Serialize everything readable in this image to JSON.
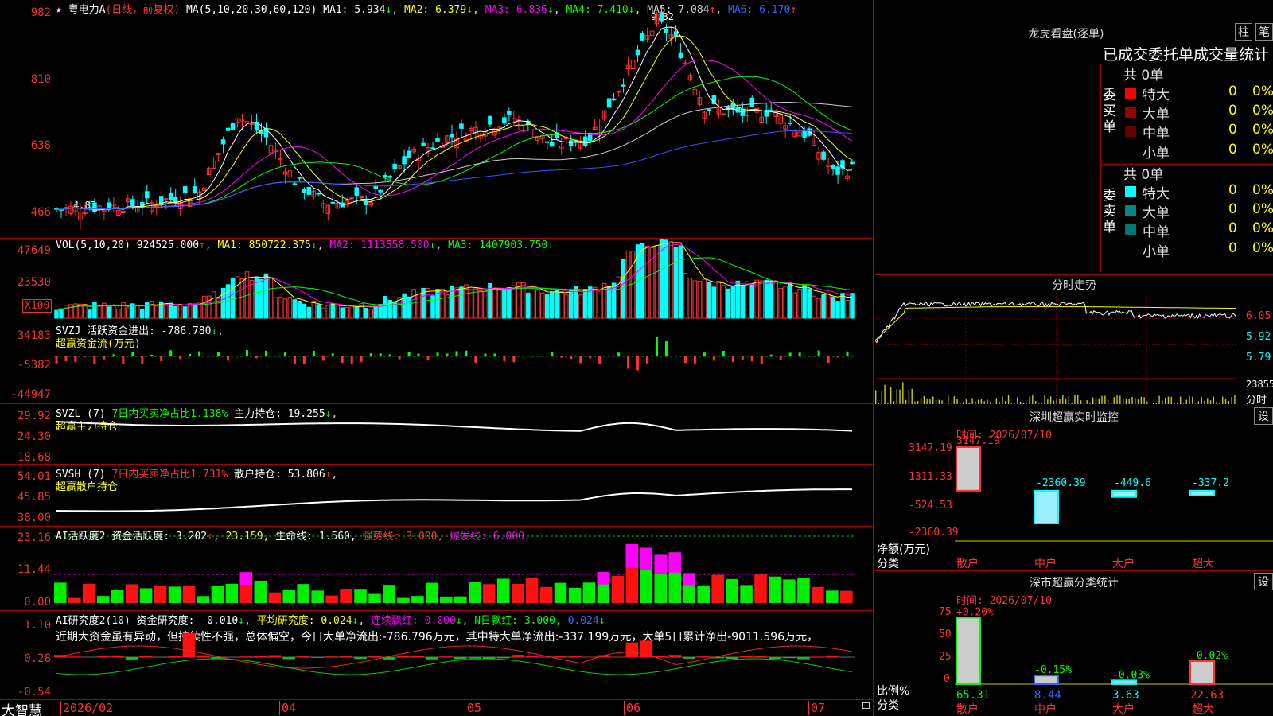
{
  "stock": {
    "name": "粤电力A",
    "mode": "(日线，前复权)",
    "ma_label": "MA(5,10,20,30,60,120)",
    "ma": [
      {
        "k": "MA1:",
        "v": "5.934",
        "arrow": "↓"
      },
      {
        "k": "MA2:",
        "v": "6.379",
        "arrow": "↓"
      },
      {
        "k": "MA3:",
        "v": "6.836",
        "arrow": "↓"
      },
      {
        "k": "MA4:",
        "v": "7.410",
        "arrow": "↓"
      },
      {
        "k": "MA5:",
        "v": "7.084",
        "arrow": "↑"
      },
      {
        "k": "MA6:",
        "v": "6.170",
        "arrow": "↑"
      }
    ],
    "y_ticks": [
      "982",
      "810",
      "638",
      "466"
    ],
    "high_mark": "9.82",
    "low_mark": "4.87"
  },
  "colors": {
    "up": "#ff3333",
    "down": "#00ffff",
    "ma1": "#ffffff",
    "ma2": "#ffff00",
    "ma3": "#ff00ff",
    "ma4": "#00ff00",
    "ma5": "#cccccc",
    "ma6": "#3355ff"
  },
  "vol": {
    "label": "VOL(5,10,20)",
    "value": "924525.000",
    "ma1": "MA1: 850722.375",
    "ma2": "MA2: 1113558.500",
    "ma3": "MA3: 1407903.750",
    "y_ticks": [
      "47649",
      "23530"
    ],
    "unit": "X100"
  },
  "svzj": {
    "label": "SVZJ",
    "text": "活跃资金进出: -786.780",
    "sub": "超赢资金流(万元)",
    "y_ticks": [
      "34183",
      "-5382",
      "-44947"
    ]
  },
  "svzl": {
    "label": "SVZL (7)",
    "text": "7日内买卖净占比1.138%",
    "main": "主力持仓: 19.255",
    "sub": "超赢主力持仓",
    "y_ticks": [
      "29.92",
      "24.30",
      "18.68"
    ]
  },
  "svsh": {
    "label": "SVSH (7)",
    "text": "7日内买卖净占比1.731%",
    "main": "散户持仓: 53.806",
    "sub": "超赢散户持仓",
    "y_ticks": [
      "54.01",
      "45.85",
      "38.00"
    ]
  },
  "ai2": {
    "label": "AI活跃度2",
    "t1": "资金活跃度: 3.202",
    "t2": "23.159,",
    "t3": "生命线: 1.560,",
    "t4": "强势线: 3.000,",
    "t5": "爆发线: 6.000,",
    "y_ticks": [
      "23.16",
      "11.44",
      "0.00"
    ]
  },
  "ai3": {
    "label": "AI研究度2(10)",
    "t1": "资金研究度: -0.010",
    "t2": "平均研究度: 0.024",
    "t3": "连续飘红: 0.000",
    "t4": "N日飘红: 3.000,",
    "t5": "0.024",
    "comment": "近期大资金虽有异动，但持续性不强，总体偏空，今日大单净流出:-786.796万元，其中特大单净流出:-337.199万元，大单5日累计净出-9011.596万元，",
    "y_ticks": [
      "1.10",
      "0.28",
      "-0.54"
    ]
  },
  "xaxis": {
    "brand": "大智慧",
    "labels": [
      "2026/02",
      "04",
      "05",
      "06",
      "07"
    ]
  },
  "lhb": {
    "title": "龙虎看盘(逐单)",
    "btn1": "柱",
    "btn2": "笔",
    "header": "已成交委托单成交量统计",
    "buy": {
      "side": "委买单",
      "count": "共 0单",
      "rows": [
        {
          "name": "特大",
          "v": "0",
          "p": "0%"
        },
        {
          "name": "大单",
          "v": "0",
          "p": "0%"
        },
        {
          "name": "中单",
          "v": "0",
          "p": "0%"
        },
        {
          "name": "小单",
          "v": "0",
          "p": "0%"
        }
      ]
    },
    "sell": {
      "side": "委卖单",
      "count": "共 0单",
      "rows": [
        {
          "name": "特大",
          "v": "0",
          "p": "0%"
        },
        {
          "name": "大单",
          "v": "0",
          "p": "0%"
        },
        {
          "name": "中单",
          "v": "0",
          "p": "0%"
        },
        {
          "name": "小单",
          "v": "0",
          "p": "0%"
        }
      ]
    }
  },
  "fenshi": {
    "title": "分时走势",
    "prices": [
      "6.05",
      "5.92",
      "5.79"
    ],
    "vol": "23855",
    "unit": "分时"
  },
  "monitor": {
    "title": "深圳超赢实时监控",
    "btn": "设",
    "time": "时间: 2026/07/10",
    "y_ticks": [
      "3147.19",
      "1311.33",
      "-524.53",
      "-2360.39"
    ],
    "bars": [
      {
        "cat": "散户",
        "v": "3147.19"
      },
      {
        "cat": "中户",
        "v": "-2360.39"
      },
      {
        "cat": "大户",
        "v": "-449.6"
      },
      {
        "cat": "超大",
        "v": "-337.2"
      }
    ],
    "ylabel": "净额(万元)",
    "xlabel": "分类"
  },
  "classify": {
    "title": "深市超赢分类统计",
    "btn": "设",
    "time": "时间: 2026/07/10",
    "y_ticks": [
      "75",
      "50",
      "25",
      "0"
    ],
    "bars": [
      {
        "cat": "散户",
        "v": "65.31",
        "chg": "+0.20%"
      },
      {
        "cat": "中户",
        "v": "8.44",
        "chg": "-0.15%"
      },
      {
        "cat": "大户",
        "v": "3.63",
        "chg": "-0.03%"
      },
      {
        "cat": "超大",
        "v": "22.63",
        "chg": "-0.02%"
      }
    ],
    "ylabel": "比例%",
    "xlabel": "分类"
  }
}
